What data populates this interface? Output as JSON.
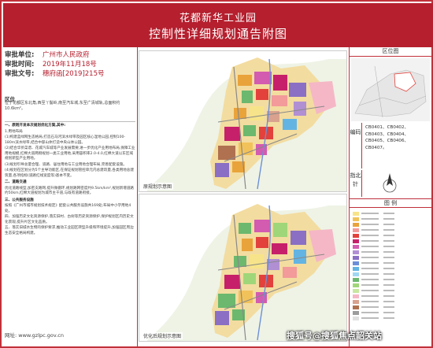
{
  "header": {
    "title": "花都新华工业园",
    "subtitle": "控制性详细规划通告附图"
  },
  "approval": {
    "unit_label": "审批单位:",
    "unit_value": "广州市人民政府",
    "time_label": "审批时间:",
    "time_value": "2019年11月18号",
    "doc_label": "审批文号:",
    "doc_value": "穗府函[2019]215号"
  },
  "location": {
    "title": "区位",
    "text": "位于花都区东北角,西至丫髻岭,南至汽车城,东至广清城轨,总面积约10.6km²。"
  },
  "policy": {
    "p0": "一、原则开发本次规划优化方案,其中:",
    "p1": "1.用地布局",
    "p2": "(1)构建蓝绿网生态格局,打造石马河滨水绿带及园区核心湿地公园,控制100-180m滨水绿带,结合中部山体打造中央山体公园。",
    "p3": "(2)结合华侨菜谱、花城汽车城等产业发展需要,进一步优化产业用地布局,保障工业用地规模,红棉大道两侧规划一类工业用地,采用容积率2.0-4.0,红棉大道以东区域规划新型产业用地。",
    "p4": "(3)规划引导总量合理、道路、居住用地与工业用地合理布局,完善配套设施。",
    "p5": "(4)规划在区划分为5个主导功能区,在保证规划管控单元内总建筑量,各类用地总建筑量,各项指标(道路红线宽度等)基本不变。",
    "p6": "二、道路交通",
    "p7": "优化道路线型,加密支路网,提升微循环,规划路网密度约9.5km/km²,规划新增道路约50km,红棉大道规划为城市主干道,与既有道路衔接。",
    "p8": "三、公共服务设施",
    "p9": "按照《广州市城市规划技术规定》配套公共服务设施共169处;布局中小学用地4处。",
    "p10": "四、加强历史文化资源保护,落实旧村、古树等历史资源保护,保护规划区内历史文化景观,提升片区文化品质。",
    "p11": "五、落实旧城水生物的保护要求,推动工业园区转型升级和环境提升,加强园区周边生态安全格局构建。"
  },
  "footer": {
    "url": "网址: www.gzlpc.gov.cn"
  },
  "maps": {
    "top_caption": "原规划示意图",
    "bottom_caption": "优化后规划示意图"
  },
  "sidebar": {
    "location_header": "区位图",
    "code_label": "编码",
    "codes": [
      "CB0401、CB0402、",
      "CB0403、CB0404、",
      "CB0405、CB0406、",
      "CB0407。"
    ],
    "north_label": "指北针",
    "legend_header": "图 例"
  },
  "legend_colors": [
    "#f7e48a",
    "#f2c25a",
    "#e9a33b",
    "#f39a9a",
    "#e3413b",
    "#c7206a",
    "#d35bb0",
    "#b18fd3",
    "#8a6fc4",
    "#6c8fd8",
    "#63b4e3",
    "#9fd7f2",
    "#6bb86e",
    "#9fd67a",
    "#c8e7a0",
    "#f5b7c6",
    "#d9a28e",
    "#b07150",
    "#9c9c9c",
    "#e0e0e0"
  ],
  "watermark": "搜狐号@搜狐焦点韶关站"
}
